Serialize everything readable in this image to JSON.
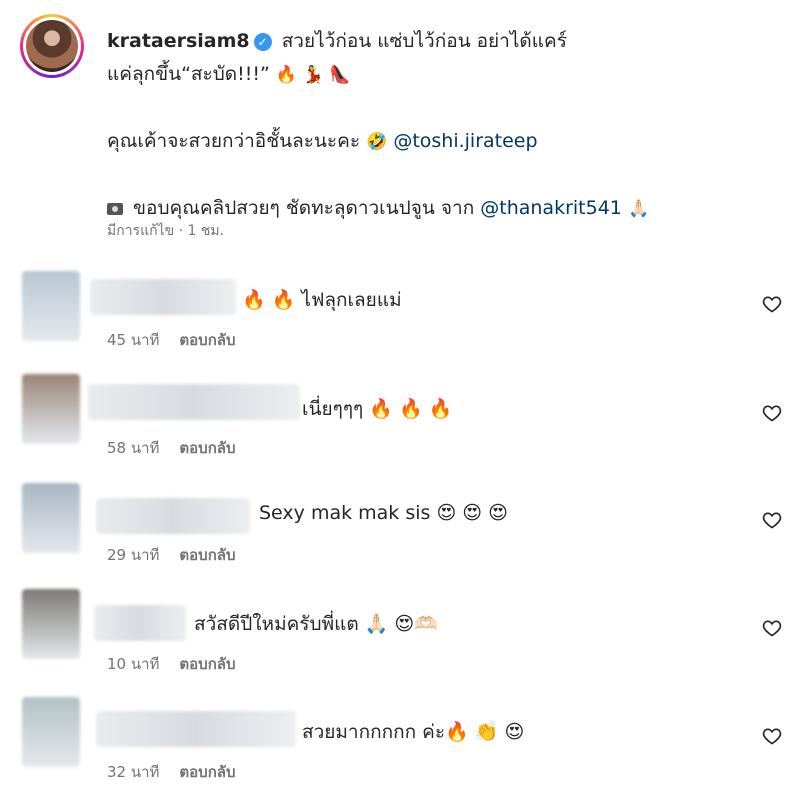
{
  "post": {
    "username": "krataersiam8",
    "caption_line1": "สวยไว้ก่อน แซ่บไว้ก่อน อย่าได้แคร์",
    "caption_line2": "แค่ลุกขึ้น“สะบัด!!!”",
    "caption_line2_emojis": "🔥 💃 👠",
    "caption_line3": "คุณเค้าจะสวยกว่าอิชั้นละนะคะ",
    "caption_line3_emoji": "🤣",
    "mention1": "@toshi.jirateep",
    "caption_line4": "ขอบคุณคลิปสวยๆ ชัดทะลุดาวเนปจูน จาก",
    "mention2": "@thanakrit541",
    "caption_line4_emoji": "🙏🏻",
    "meta": "มีการแก้ไข · 1 ชม."
  },
  "comments": [
    {
      "text": "🔥 🔥  ไฟลุกเลยแม่",
      "time": "45 นาที",
      "reply": "ตอบกลับ",
      "avatar_color": "#b9c7d3"
    },
    {
      "text": "เนี่ยๆๆๆ 🔥 🔥 🔥",
      "time": "58 นาที",
      "reply": "ตอบกลับ",
      "avatar_color": "#9a8478"
    },
    {
      "text": "Sexy mak mak sis 😍 😍 😍",
      "time": "29 นาที",
      "reply": "ตอบกลับ",
      "avatar_color": "#a9b6c2"
    },
    {
      "text": "สวัสดีปีใหม่ครับพี่แต 🙏🏻 😍🫶🏻",
      "time": "10 นาที",
      "reply": "ตอบกลับ",
      "avatar_color": "#7d7a74"
    },
    {
      "text": "สวยมากกกกก ค่ะ🔥 👏 😍",
      "time": "32 นาที",
      "reply": "ตอบกลับ",
      "avatar_color": "#b3c1c4"
    }
  ]
}
